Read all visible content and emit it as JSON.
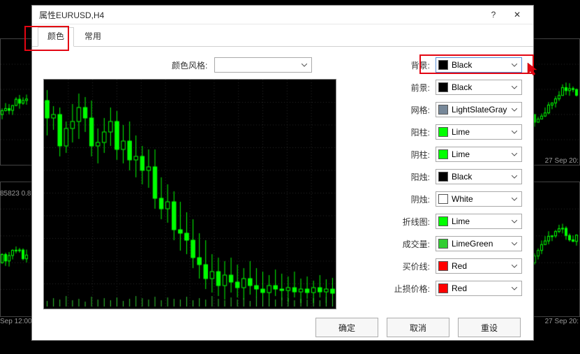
{
  "dialog": {
    "title": "属性EURUSD,H4",
    "help_glyph": "?",
    "close_glyph": "✕"
  },
  "tabs": {
    "active": "颜色",
    "list": [
      "颜色",
      "常用"
    ]
  },
  "style": {
    "label": "颜色风格:",
    "value": ""
  },
  "options": [
    {
      "label": "背景:",
      "color": "#000000",
      "name": "Black"
    },
    {
      "label": "前景:",
      "color": "#000000",
      "name": "Black"
    },
    {
      "label": "网格:",
      "color": "#778899",
      "name": "LightSlateGray"
    },
    {
      "label": "阳柱:",
      "color": "#00ff00",
      "name": "Lime"
    },
    {
      "label": "阴柱:",
      "color": "#00ff00",
      "name": "Lime"
    },
    {
      "label": "阳烛:",
      "color": "#000000",
      "name": "Black"
    },
    {
      "label": "阴烛:",
      "color": "#ffffff",
      "name": "White"
    },
    {
      "label": "折线图:",
      "color": "#00ff00",
      "name": "Lime"
    },
    {
      "label": "成交量:",
      "color": "#32cd32",
      "name": "LimeGreen"
    },
    {
      "label": "买价线:",
      "color": "#ff0000",
      "name": "Red"
    },
    {
      "label": "止损价格:",
      "color": "#ff0000",
      "name": "Red"
    }
  ],
  "buttons": {
    "ok": "确定",
    "cancel": "取消",
    "reset": "重设"
  },
  "bg_times": {
    "a": "Sep 12:00",
    "b": "27 Sep 20:",
    "c": "27 Sep 20:"
  },
  "bg_price": "85823 0.8",
  "chart_data": {
    "type": "candlestick",
    "note": "Pixel-approximated OHLC preview of EURUSD H4; values are canvas Y-pixels (0=top) with no axis scale shown in image",
    "candles": [
      [
        30,
        15,
        80,
        55
      ],
      [
        55,
        38,
        72,
        50
      ],
      [
        50,
        40,
        110,
        95
      ],
      [
        95,
        60,
        105,
        70
      ],
      [
        70,
        35,
        90,
        60
      ],
      [
        60,
        20,
        85,
        40
      ],
      [
        40,
        25,
        75,
        55
      ],
      [
        55,
        30,
        110,
        95
      ],
      [
        95,
        70,
        120,
        90
      ],
      [
        90,
        55,
        105,
        75
      ],
      [
        75,
        40,
        95,
        60
      ],
      [
        60,
        45,
        115,
        100
      ],
      [
        100,
        65,
        120,
        88
      ],
      [
        88,
        60,
        130,
        115
      ],
      [
        115,
        80,
        140,
        110
      ],
      [
        110,
        95,
        150,
        130
      ],
      [
        130,
        100,
        155,
        125
      ],
      [
        125,
        100,
        185,
        170
      ],
      [
        170,
        140,
        200,
        185
      ],
      [
        185,
        150,
        205,
        175
      ],
      [
        175,
        160,
        230,
        215
      ],
      [
        215,
        175,
        245,
        220
      ],
      [
        220,
        190,
        250,
        230
      ],
      [
        230,
        200,
        270,
        255
      ],
      [
        255,
        220,
        285,
        265
      ],
      [
        265,
        230,
        300,
        285
      ],
      [
        285,
        250,
        305,
        275
      ],
      [
        275,
        255,
        310,
        295
      ],
      [
        295,
        260,
        315,
        280
      ],
      [
        280,
        255,
        305,
        290
      ],
      [
        290,
        265,
        312,
        298
      ],
      [
        298,
        270,
        315,
        285
      ],
      [
        285,
        260,
        308,
        295
      ],
      [
        295,
        270,
        312,
        300
      ],
      [
        300,
        275,
        318,
        305
      ],
      [
        305,
        280,
        315,
        295
      ],
      [
        295,
        272,
        310,
        300
      ],
      [
        300,
        278,
        316,
        302
      ],
      [
        302,
        282,
        318,
        298
      ],
      [
        298,
        275,
        312,
        304
      ],
      [
        304,
        285,
        320,
        300
      ],
      [
        300,
        282,
        314,
        305
      ],
      [
        305,
        288,
        320,
        298
      ],
      [
        298,
        280,
        312,
        304
      ],
      [
        304,
        286,
        320,
        300
      ],
      [
        300,
        284,
        316,
        306
      ]
    ],
    "volumes": [
      8,
      12,
      10,
      15,
      9,
      11,
      7,
      14,
      10,
      12,
      9,
      13,
      8,
      11,
      15,
      12,
      10,
      14,
      9,
      13,
      11,
      10,
      14,
      9,
      12,
      10,
      15,
      11,
      9,
      13,
      10,
      12,
      8,
      14,
      9,
      11,
      10,
      13,
      12,
      9,
      11,
      10,
      12,
      9,
      14,
      10
    ]
  }
}
